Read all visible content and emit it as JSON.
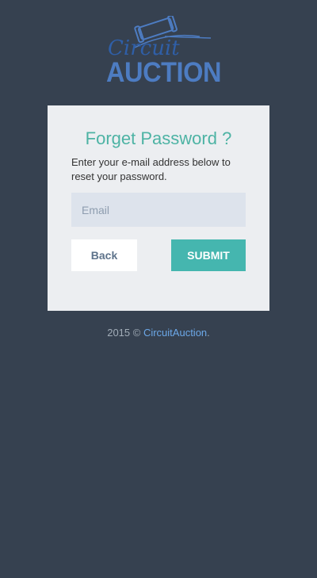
{
  "logo": {
    "script_text": "Circuit",
    "main_text": "AUCTION"
  },
  "card": {
    "title": "Forget Password ?",
    "description": "Enter your e-mail address below to reset your password.",
    "email_placeholder": "Email",
    "email_value": "",
    "back_label": "Back",
    "submit_label": "SUBMIT"
  },
  "footer": {
    "prefix": "2015 © ",
    "link_text": "CircuitAuction",
    "suffix": "."
  },
  "colors": {
    "background": "#364150",
    "accent_teal": "#4db3a4",
    "submit_button": "#45b6af",
    "logo_blue": "#4d7cc2",
    "link_blue": "#6ca8e8"
  }
}
